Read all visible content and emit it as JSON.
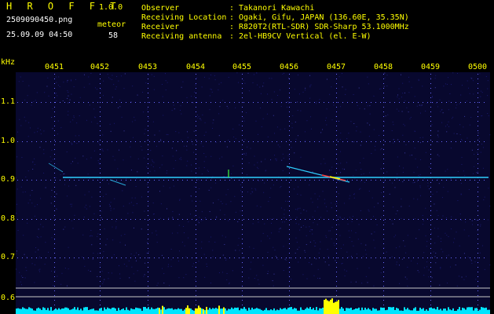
{
  "header": {
    "app_title": "H R O F F T",
    "app_version": "1.0.0",
    "filename": "2509090450.png",
    "datetime": "25.09.09 04:50",
    "meteor_label": "meteor",
    "meteor_count": "58"
  },
  "info": {
    "rows": [
      {
        "key": "Observer",
        "value": "Takanori Kawachi"
      },
      {
        "key": "Receiving Location",
        "value": "Ogaki, Gifu, JAPAN (136.60E, 35.35N)"
      },
      {
        "key": "Receiver",
        "value": "R820T2(RTL-SDR) SDR-Sharp 53.1000MHz"
      },
      {
        "key": "Receiving antenna",
        "value": "2el-HB9CV Vertical (el. E-W)"
      }
    ]
  },
  "axis": {
    "freq_unit": "kHz",
    "time_ticks": [
      "0451",
      "0452",
      "0453",
      "0454",
      "0455",
      "0456",
      "0457",
      "0458",
      "0459",
      "0500"
    ],
    "freq_ticks": [
      "1.1",
      "1.0",
      "0.9",
      "0.8",
      "0.7",
      "0.6"
    ]
  },
  "colors": {
    "label": "#ffff00",
    "background": "#000000",
    "noise": "#1a1a6e",
    "carrier": "#2fd0ff",
    "baseline": "#00e5ff"
  }
}
